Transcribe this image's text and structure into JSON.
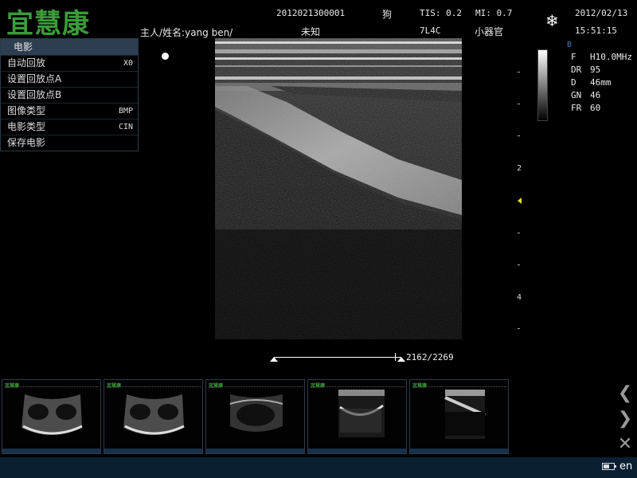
{
  "header": {
    "logo": "宜慧康",
    "exam_id": "2012021300001",
    "species": "狗",
    "tis": "TIS: 0.2",
    "mi": "MI: 0.7",
    "date": "2012/02/13",
    "owner_name": "主人/姓名:yang ben/",
    "sex": "未知",
    "probe": "7L4C",
    "preset": "小器官",
    "time": "15:51:15",
    "freeze_icon": "snowflake-icon"
  },
  "cine_menu": {
    "title": "电影",
    "items": [
      {
        "label": "自动回放",
        "value": "X0"
      },
      {
        "label": "设置回放点A",
        "value": ""
      },
      {
        "label": "设置回放点B",
        "value": ""
      },
      {
        "label": "图像类型",
        "value": "BMP"
      },
      {
        "label": "电影类型",
        "value": "CIN"
      },
      {
        "label": "保存电影",
        "value": ""
      }
    ]
  },
  "params": {
    "mode": "B",
    "rows": [
      {
        "key": "F",
        "value": "H10.0MHz"
      },
      {
        "key": "DR",
        "value": "95"
      },
      {
        "key": "D",
        "value": "46mm"
      },
      {
        "key": "GN",
        "value": "46"
      },
      {
        "key": "FR",
        "value": "60"
      }
    ]
  },
  "depth_scale": {
    "labels": [
      "2",
      "4"
    ],
    "colors": {
      "focus_marker": "#e8e020"
    }
  },
  "cine": {
    "counter": "2162/2269",
    "current_frame": 2162,
    "total_frames": 2269
  },
  "thumbnails": {
    "count": 5,
    "mini_logo": "宜慧康"
  },
  "nav": {
    "prev_icon": "chevron-left-icon",
    "next_icon": "chevron-right-icon",
    "delete_icon": "close-icon"
  },
  "status": {
    "language": "en",
    "battery_icon": "battery-icon",
    "battery_level": 0.6
  },
  "colors": {
    "brand": "#3b9c3a",
    "menu_title_bg": "#2e3e52",
    "status_bar": "#0b1f33",
    "mode_label": "#4b7cc7"
  }
}
